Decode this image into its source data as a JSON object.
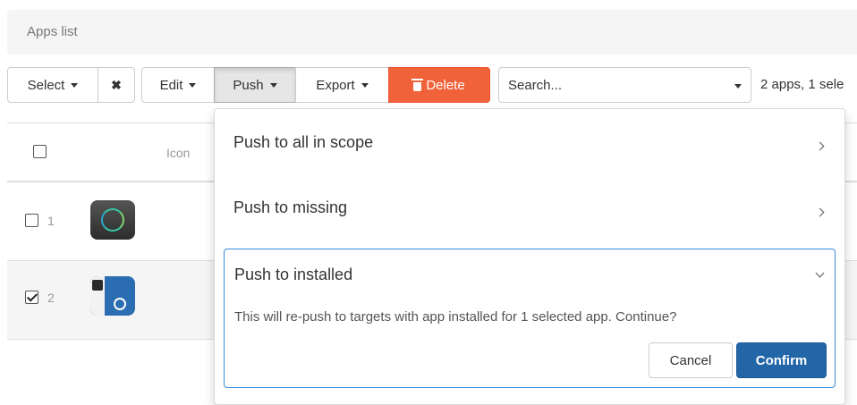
{
  "breadcrumb": {
    "title": "Apps list"
  },
  "toolbar": {
    "select_label": "Select",
    "clear_symbol": "✖",
    "edit_label": "Edit",
    "push_label": "Push",
    "export_label": "Export",
    "delete_label": "Delete",
    "search_placeholder": "Search...",
    "count_text": "2 apps, 1 sele"
  },
  "table": {
    "columns": [
      "",
      "Icon"
    ],
    "rows": [
      {
        "index": "1",
        "checked": false,
        "icon": "sync-app-icon"
      },
      {
        "index": "2",
        "checked": true,
        "icon": "directory-globe-app-icon"
      }
    ]
  },
  "push_menu": {
    "items": [
      {
        "label": "Push to all in scope"
      },
      {
        "label": "Push to missing"
      }
    ],
    "expanded": {
      "label": "Push to installed",
      "message": "This will re-push to targets with app installed for 1 selected app. Continue?",
      "cancel_label": "Cancel",
      "confirm_label": "Confirm"
    }
  },
  "colors": {
    "delete": "#f0623a",
    "confirm": "#2366a8",
    "focus_border": "#3a8ee0"
  }
}
